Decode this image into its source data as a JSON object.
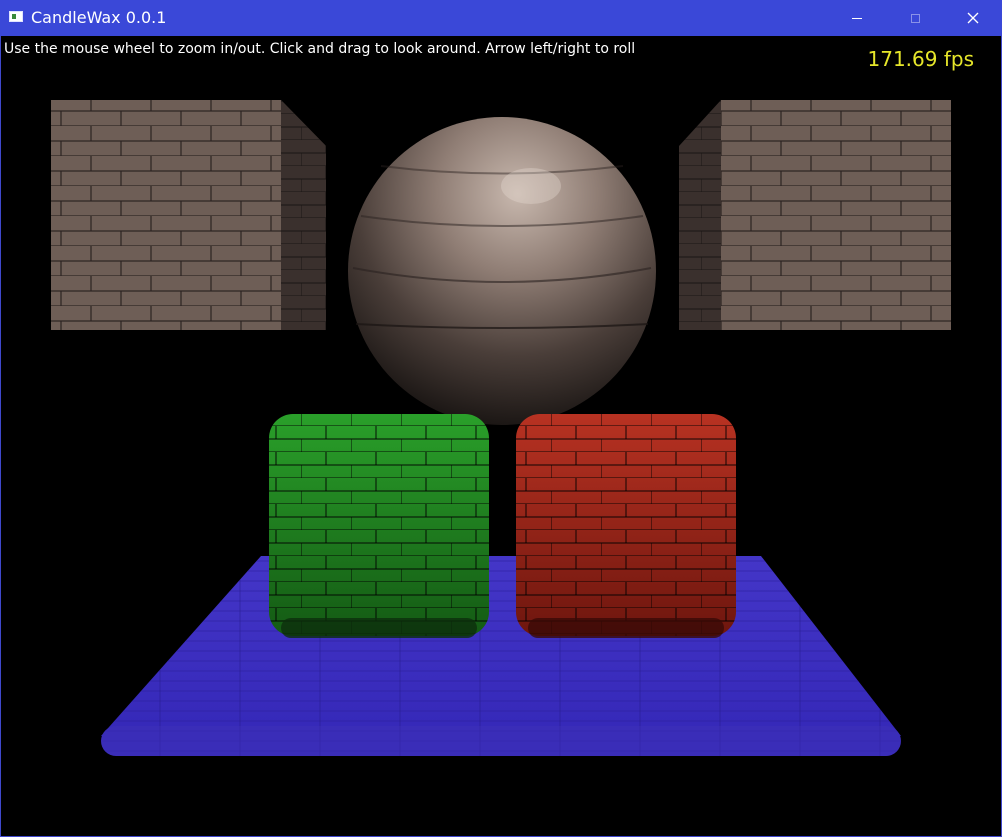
{
  "window": {
    "title": "CandleWax 0.0.1",
    "controls": {
      "minimize": "minimize",
      "maximize": "maximize",
      "close": "close"
    }
  },
  "overlay": {
    "instructions": "Use the mouse wheel to zoom in/out. Click and drag to look around. Arrow left/right to roll",
    "fps": "171.69 fps"
  },
  "scene": {
    "objects": [
      {
        "name": "brick-cube-left",
        "color": "#6a5a52"
      },
      {
        "name": "brick-sphere",
        "color": "#8a7a72"
      },
      {
        "name": "brick-cube-right",
        "color": "#6a5a52"
      },
      {
        "name": "green-rounded-cube",
        "color": "#1f8a1f"
      },
      {
        "name": "red-rounded-cube",
        "color": "#a0281c"
      },
      {
        "name": "blue-floor-slab",
        "color": "#3a2fc0"
      }
    ]
  },
  "colors": {
    "titlebar": "#3a48d8",
    "fps_text": "#e6e62a",
    "instruction_text": "#ffffff",
    "background": "#000000"
  }
}
